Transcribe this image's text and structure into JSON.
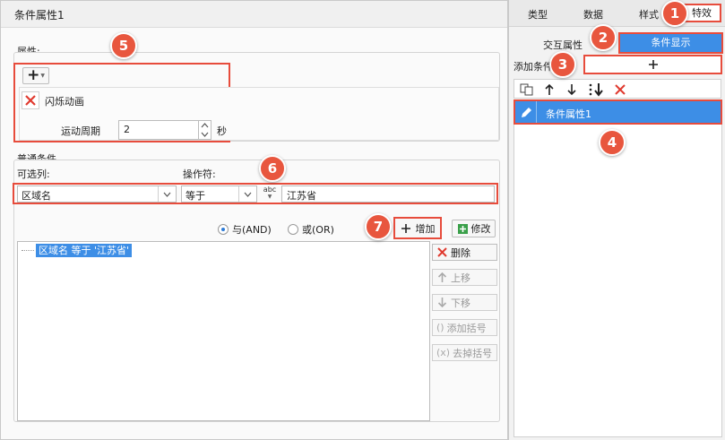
{
  "dialog": {
    "title": "条件属性1"
  },
  "properties": {
    "section_label": "属性:",
    "add_symbol": "+",
    "item_label": "闪烁动画",
    "period_label": "运动周期",
    "period_value": "2",
    "period_unit": "秒"
  },
  "conditions": {
    "section_label": "普通条件",
    "column_label": "可选列:",
    "operator_label": "操作符:",
    "column_value": "区域名",
    "operator_value": "等于",
    "value_icon_text": "abc",
    "value_text": "江苏省",
    "and_label": "与(AND)",
    "or_label": "或(OR)",
    "add_label": "增加",
    "modify_label": "修改",
    "list_item": "区域名 等于 '江苏省'",
    "side_buttons": [
      "删除",
      "上移",
      "下移",
      "添加括号",
      "去掉括号"
    ]
  },
  "right_panel": {
    "tabs": [
      "类型",
      "数据",
      "样式",
      "特效"
    ],
    "subtabs": [
      "交互属性",
      "条件显示"
    ],
    "add_condition_label": "添加条件",
    "add_symbol": "+",
    "item_label": "条件属性1"
  },
  "badges": [
    "1",
    "2",
    "3",
    "4",
    "5",
    "6",
    "7"
  ],
  "colors": {
    "accent_blue": "#3d8ee6",
    "highlight_red": "#e74c3c",
    "badge_red": "#e8563e"
  }
}
